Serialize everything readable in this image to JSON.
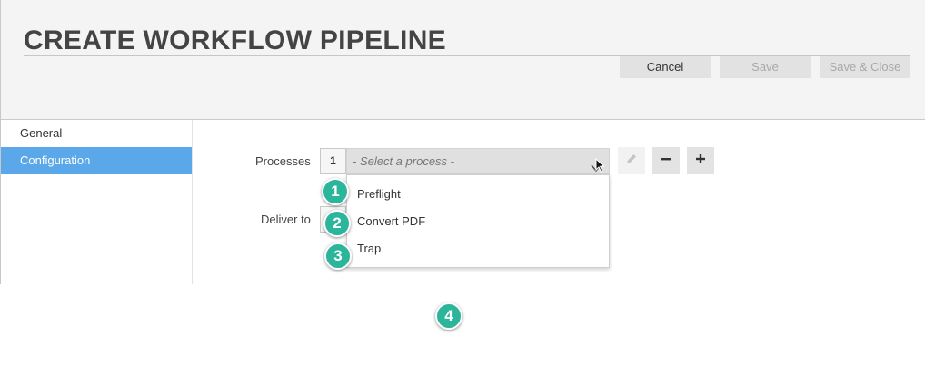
{
  "header": {
    "title": "CREATE WORKFLOW PIPELINE",
    "buttons": {
      "cancel": "Cancel",
      "save": "Save",
      "save_close": "Save & Close"
    }
  },
  "sidebar": {
    "items": [
      {
        "label": "General",
        "active": false
      },
      {
        "label": "Configuration",
        "active": true
      }
    ]
  },
  "form": {
    "processes_label": "Processes",
    "process_index": "1",
    "process_placeholder": "- Select a process -",
    "deliver_to_label": "Deliver to"
  },
  "dropdown": {
    "options": [
      "Preflight",
      "Convert PDF",
      "Trap"
    ]
  },
  "callouts": [
    "1",
    "2",
    "3",
    "4"
  ],
  "colors": {
    "accent": "#5aa7ea",
    "callout": "#2bb59a",
    "header_bg": "#f4f4f4",
    "disabled_text": "#a8a8a8"
  },
  "icons": {
    "edit": "pencil-icon",
    "remove": "minus-icon",
    "add": "plus-icon",
    "select_arrow": "chevron-down-icon"
  }
}
